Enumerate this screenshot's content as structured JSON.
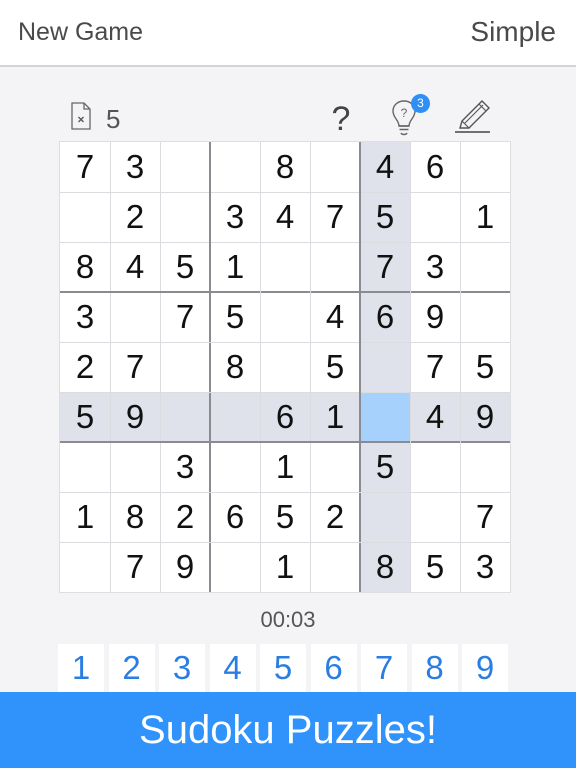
{
  "header": {
    "new_game_label": "New Game",
    "difficulty_label": "Simple"
  },
  "toolbar": {
    "mistakes_icon": "file-x-icon",
    "mistakes_count": "5",
    "help_label": "?",
    "hint_icon": "lightbulb-question-icon",
    "hint_badge": "3",
    "pencil_icon": "pencil-icon"
  },
  "grid": {
    "cells": [
      [
        "7",
        "3",
        "",
        "",
        "8",
        "",
        "4",
        "6",
        ""
      ],
      [
        "",
        "2",
        "",
        "3",
        "4",
        "7",
        "5",
        "",
        "1"
      ],
      [
        "8",
        "4",
        "5",
        "1",
        "",
        "",
        "7",
        "3",
        ""
      ],
      [
        "3",
        "",
        "7",
        "5",
        "",
        "4",
        "6",
        "9",
        ""
      ],
      [
        "2",
        "7",
        "",
        "8",
        "",
        "5",
        "",
        "7",
        "5"
      ],
      [
        "5",
        "9",
        "",
        "",
        "6",
        "1",
        "",
        "4",
        "9"
      ],
      [
        "",
        "",
        "3",
        "",
        "1",
        "",
        "5",
        "",
        ""
      ],
      [
        "1",
        "8",
        "2",
        "6",
        "5",
        "2",
        "",
        "",
        "7"
      ],
      [
        "",
        "7",
        "9",
        "",
        "1",
        "",
        "8",
        "5",
        "3"
      ]
    ],
    "selected": {
      "row": 5,
      "col": 6
    },
    "colors": {
      "highlight": "#dfe2ea",
      "selected": "#a6d1fc"
    }
  },
  "timer": "00:03",
  "numpad": [
    "1",
    "2",
    "3",
    "4",
    "5",
    "6",
    "7",
    "8",
    "9"
  ],
  "banner": {
    "text": "Sudoku Puzzles!",
    "color": "#2f93fb"
  },
  "colors": {
    "accent": "#2a7de1",
    "badge": "#2f8ff5"
  }
}
